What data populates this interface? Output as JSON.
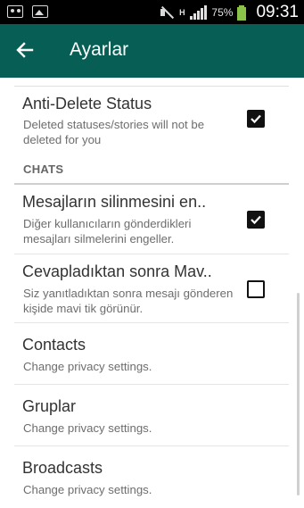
{
  "statusbar": {
    "network": "H",
    "battery": "75%",
    "time": "09:31",
    "icons": [
      "notification-dots-icon",
      "gallery-icon",
      "mute-icon",
      "signal-icon",
      "battery-icon"
    ]
  },
  "appbar": {
    "title": "Ayarlar",
    "back_icon": "arrow-left-icon"
  },
  "settings": {
    "anti_delete": {
      "title": "Anti-Delete Status",
      "summary": "Deleted statuses/stories will not be deleted for you",
      "checked": true
    },
    "section_chats": "CHATS",
    "anti_delete_msg": {
      "title": "Mesajların silinmesini en..",
      "summary": "Diğer kullanıcıların gönderdikleri mesajları silmelerini engeller.",
      "checked": true
    },
    "blue_tick": {
      "title": "Cevapladıktan sonra Mav..",
      "summary": "Siz yanıtladıktan sonra mesajı gönderen kişide mavi tik görünür.",
      "checked": false
    },
    "contacts": {
      "title": "Contacts",
      "summary": "Change privacy settings."
    },
    "groups": {
      "title": "Gruplar",
      "summary": "Change privacy settings."
    },
    "broadcasts": {
      "title": "Broadcasts",
      "summary": "Change privacy settings."
    }
  },
  "colors": {
    "appbar": "#075e54",
    "statusbar": "#000000",
    "battery": "#8bc34a"
  }
}
